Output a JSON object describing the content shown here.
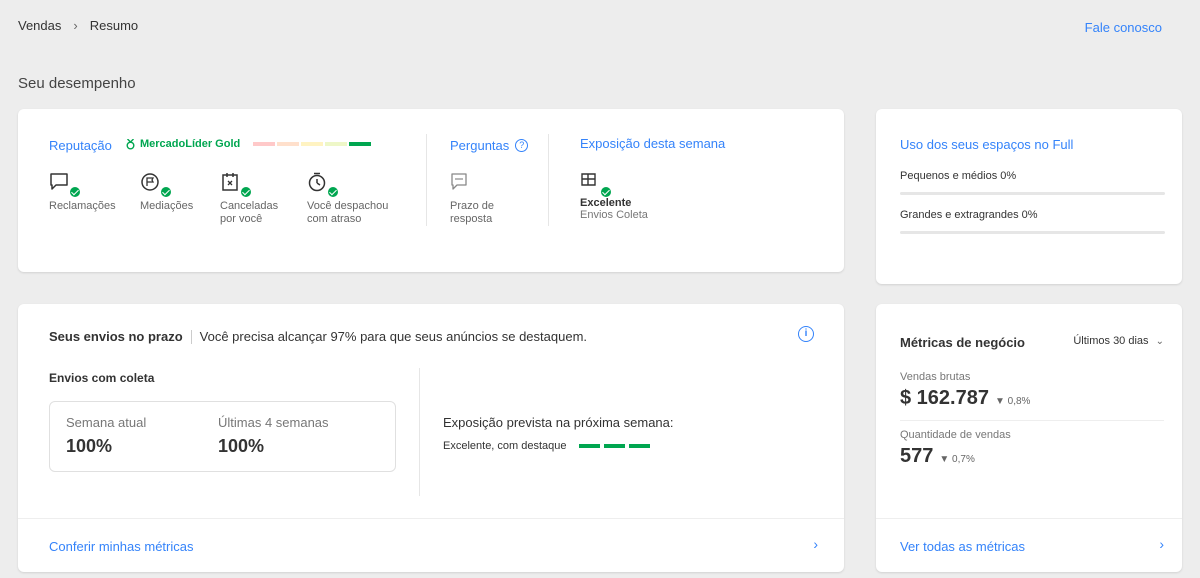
{
  "breadcrumb": {
    "root": "Vendas",
    "current": "Resumo"
  },
  "contact_link": "Fale conosco",
  "section_title": "Seu desempenho",
  "reputation": {
    "title": "Reputação",
    "level": "MercadoLíder Gold",
    "thermometer_colors": [
      "#ffc9c9",
      "#ffe0cc",
      "#fff3c2",
      "#eef7c8",
      "#00a650"
    ],
    "metrics": [
      {
        "icon": "chat-icon",
        "label_l1": "Reclamações",
        "label_l2": ""
      },
      {
        "icon": "flag-icon",
        "label_l1": "Mediações",
        "label_l2": ""
      },
      {
        "icon": "cancelled-icon",
        "label_l1": "Canceladas",
        "label_l2": "por você"
      },
      {
        "icon": "stopwatch-icon",
        "label_l1": "Você despachou",
        "label_l2": "com atraso"
      }
    ]
  },
  "questions": {
    "title": "Perguntas",
    "help": "?",
    "label_l1": "Prazo de",
    "label_l2": "resposta"
  },
  "exposure": {
    "title": "Exposição desta semana",
    "value": "Excelente",
    "sub": "Envios Coleta"
  },
  "full_space": {
    "title": "Uso dos seus espaços no Full",
    "rows": [
      {
        "label": "Pequenos e médios 0%",
        "progress": 0
      },
      {
        "label": "Grandes e extragrandes 0%",
        "progress": 0
      }
    ]
  },
  "shipping": {
    "title": "Seus envios no prazo",
    "message": "Você precisa alcançar 97% para que seus anúncios se destaquem.",
    "info": "i",
    "subtitle": "Envios com coleta",
    "current_week_label": "Semana atual",
    "current_week_value": "100%",
    "last4_label": "Últimas 4 semanas",
    "last4_value": "100%",
    "forecast_title": "Exposição prevista na próxima semana:",
    "forecast_value": "Excelente, com destaque",
    "footer_link": "Conferir minhas métricas"
  },
  "business": {
    "title": "Métricas de negócio",
    "period": "Últimos 30 dias",
    "gross_label": "Vendas brutas",
    "gross_value": "$ 162.787",
    "gross_delta": "▼ 0,8%",
    "qty_label": "Quantidade de vendas",
    "qty_value": "577",
    "qty_delta": "▼ 0,7%",
    "footer_link": "Ver todas as métricas"
  },
  "colors": {
    "accent": "#3483fa",
    "success": "#00a650",
    "background": "#ededed"
  }
}
